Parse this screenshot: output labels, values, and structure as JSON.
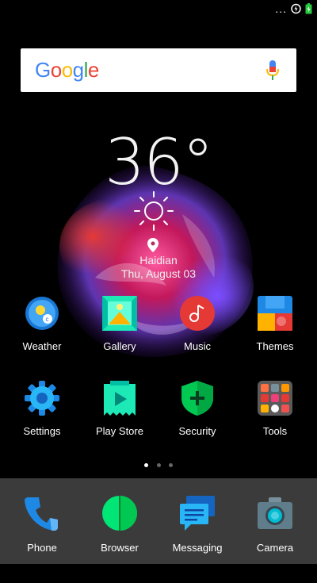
{
  "status": {
    "dots": "..."
  },
  "search": {
    "logo": "Google"
  },
  "weather_widget": {
    "temperature": "36°",
    "city": "Haidian",
    "date": "Thu, August 03"
  },
  "apps_row1": [
    {
      "label": "Weather"
    },
    {
      "label": "Gallery"
    },
    {
      "label": "Music"
    },
    {
      "label": "Themes"
    }
  ],
  "apps_row2": [
    {
      "label": "Settings"
    },
    {
      "label": "Play Store"
    },
    {
      "label": "Security"
    },
    {
      "label": "Tools"
    }
  ],
  "dock": [
    {
      "label": "Phone"
    },
    {
      "label": "Browser"
    },
    {
      "label": "Messaging"
    },
    {
      "label": "Camera"
    }
  ],
  "page_indicator": {
    "count": 3,
    "active": 0
  },
  "colors": {
    "dock_bg": "#3b3b3b",
    "accent_teal": "#1de9b6",
    "accent_blue": "#2196f3"
  }
}
